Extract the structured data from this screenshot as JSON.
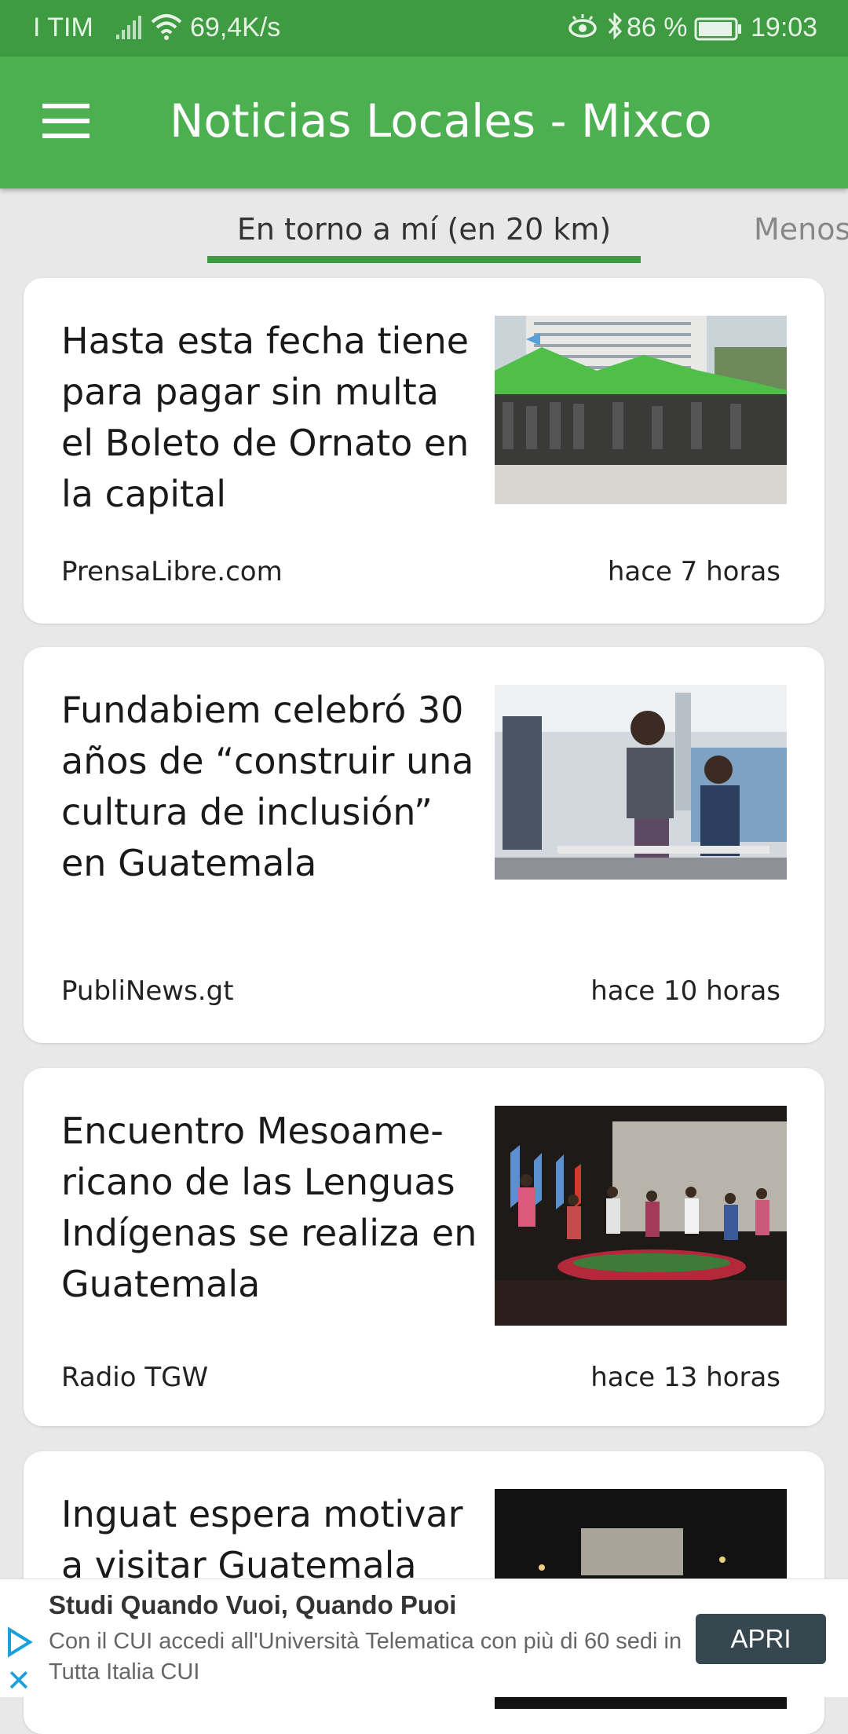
{
  "status_bar": {
    "carrier": "I TIM",
    "speed": "69,4K/s",
    "battery": "86 %",
    "time": "19:03"
  },
  "app_bar": {
    "title": "Noticias Locales - Mixco"
  },
  "tabs": [
    {
      "label": "En torno a mí (en 20 km)",
      "active": true
    },
    {
      "label": "Menos",
      "active": false
    }
  ],
  "articles": [
    {
      "headline": "Hasta esta fecha tiene para pagar sin multa el Boleto de Ornato en la capital",
      "source": "PrensaLibre.com",
      "age": "hace 7 horas"
    },
    {
      "headline": "Fundabiem celebró 30 años de “construir una cultura de inclusión” en Guatemala",
      "source": "PubliNews.gt",
      "age": "hace 10 horas"
    },
    {
      "headline": "Encuentro Mesoame-ricano de las Lenguas Indígenas se realiza en Guatemala",
      "source": "Radio TGW",
      "age": "hace 13 horas"
    },
    {
      "headline": "Inguat espera motivar a visitar Guatemala"
    }
  ],
  "ad": {
    "title": "Studi Quando Vuoi, Quando Puoi",
    "body": "Con il CUI accedi all'Università Telematica con più di 60 sedi in Tutta Italia CUI",
    "button": "APRI"
  }
}
